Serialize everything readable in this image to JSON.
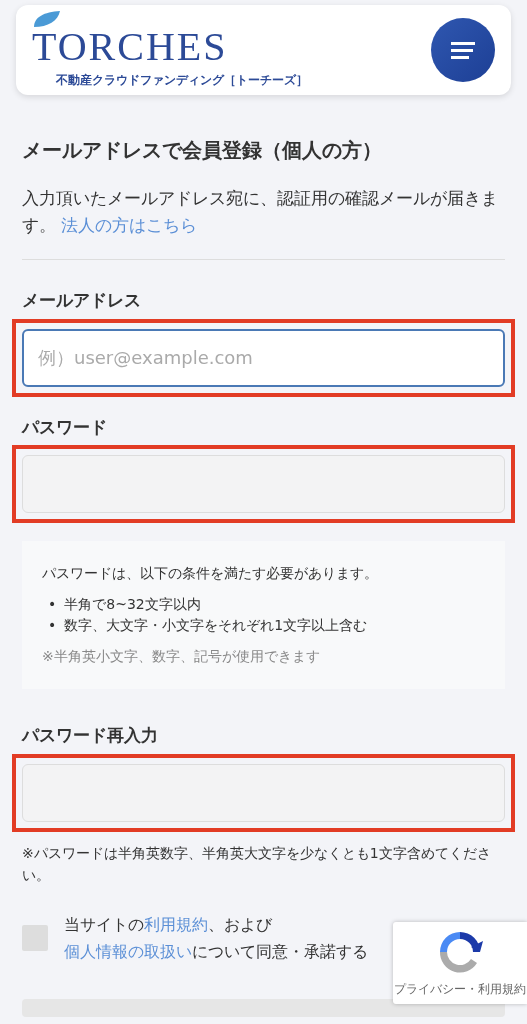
{
  "header": {
    "logo": "TORCHES",
    "tagline": "不動産クラウドファンディング［トーチーズ］"
  },
  "title": "メールアドレスで会員登録（個人の方）",
  "intro": {
    "text": "入力頂いたメールアドレス宛に、認証用の確認メールが届きます。",
    "link": "法人の方はこちら"
  },
  "fields": [
    {
      "label": "メールアドレス",
      "placeholder": "例）user@example.com",
      "focused": true,
      "highlighted": true
    },
    {
      "label": "パスワード",
      "focused": false,
      "highlighted": true,
      "help": {
        "lead": "パスワードは、以下の条件を満たす必要があります。",
        "rules": [
          {
            "bullet": "•",
            "text": "半角で8~32文字以内"
          },
          {
            "bullet": "•",
            "text": "数字、大文字・小文字をそれぞれ1文字以上含む"
          }
        ],
        "note": "※半角英小文字、数字、記号が使用できます"
      }
    },
    {
      "label": "パスワード再入力",
      "focused": false,
      "highlighted": true,
      "note": "※パスワードは半角英数字、半角英大文字を少なくとも1文字含めてください。"
    }
  ],
  "agreement": {
    "checked": false,
    "parts": [
      {
        "text": "当サイトの",
        "kind": "text"
      },
      {
        "text": "利用規約",
        "kind": "link"
      },
      {
        "text": "、および",
        "kind": "text"
      },
      {
        "text": "個人情報の取扱い",
        "kind": "link"
      },
      {
        "text": "について同意・承諾する",
        "kind": "text"
      }
    ]
  },
  "recaptcha": {
    "links": "プライバシー・利用規約"
  },
  "submit": {
    "disabled": true
  }
}
